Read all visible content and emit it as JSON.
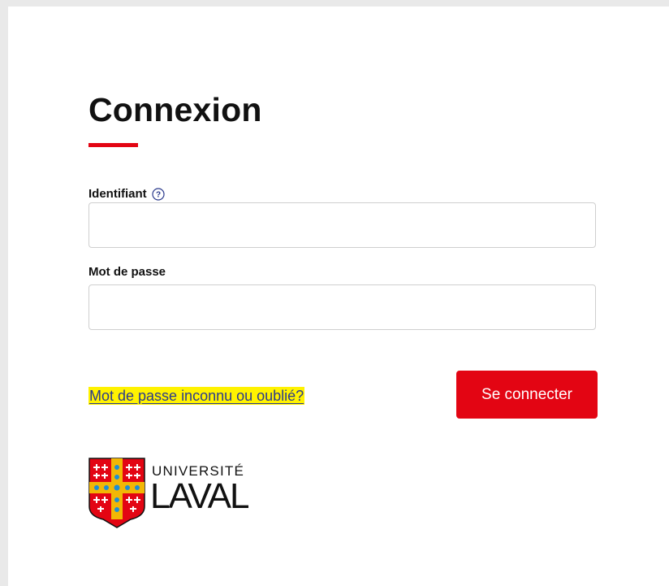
{
  "login": {
    "title": "Connexion",
    "identifier_label": "Identifiant",
    "identifier_value": "",
    "identifier_placeholder": "",
    "password_label": "Mot de passe",
    "password_value": "",
    "password_placeholder": "",
    "forgot_link": "Mot de passe inconnu ou oublié?",
    "submit_label": "Se connecter"
  },
  "logo": {
    "line1": "UNIVERSITÉ",
    "line2": "LAVAL"
  },
  "colors": {
    "accent": "#e30513",
    "highlight": "#fff200",
    "link": "#2b3a8c",
    "logo_gold": "#f2b705",
    "logo_blue": "#1d8fd3"
  },
  "icons": {
    "help": "question-circle-icon",
    "logo": "university-shield-icon"
  }
}
